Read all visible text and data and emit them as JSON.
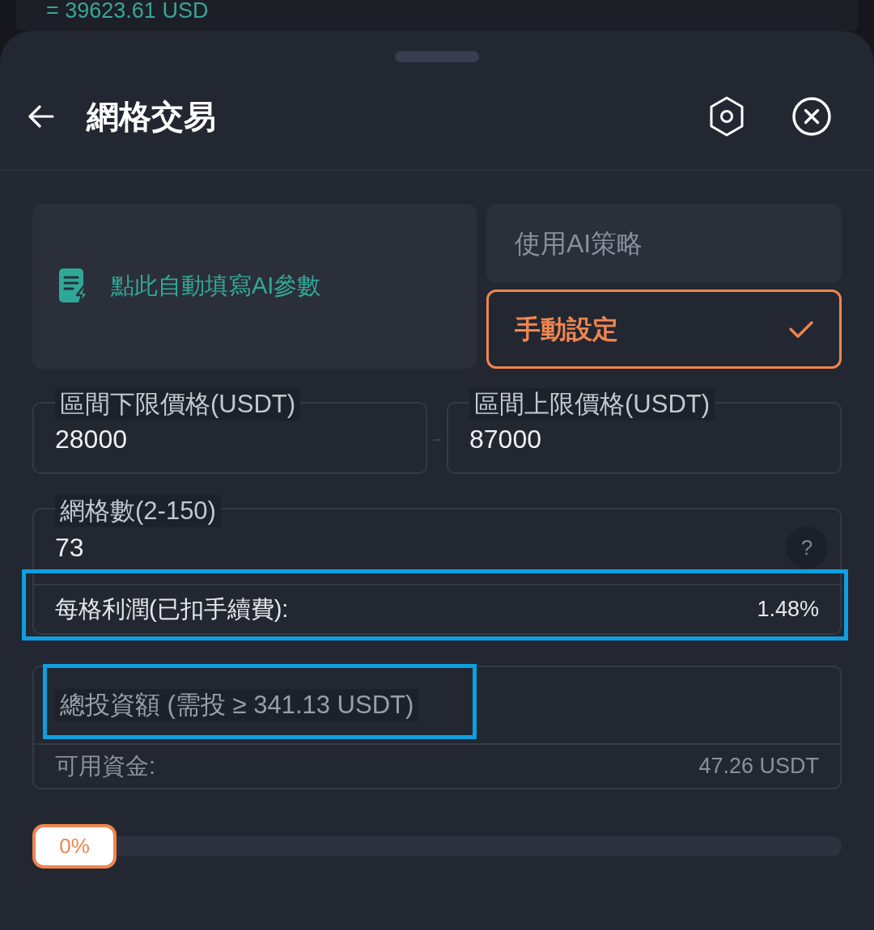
{
  "behind_sheet": {
    "balance": "= 39623.61 USD"
  },
  "sheet": {
    "title": "網格交易"
  },
  "ai_fill_button": {
    "label": "點此自動填寫AI參數"
  },
  "mode_options": [
    {
      "label": "使用AI策略",
      "selected": false
    },
    {
      "label": "手動設定",
      "selected": true
    }
  ],
  "price_range": [
    {
      "label": "區間下限價格(USDT)",
      "value": "28000"
    },
    {
      "label": "區間上限價格(USDT)",
      "value": "87000"
    }
  ],
  "grid_count": {
    "label": "網格數(2-150)",
    "value": "73",
    "help": "?"
  },
  "profit_row": {
    "label": "每格利潤(已扣手續費):",
    "value": "1.48%",
    "highlighted": true
  },
  "investment": {
    "label": "總投資額 (需投 ≥ 341.13 USDT)",
    "highlighted": true,
    "available_label": "可用資金:",
    "available_value": "47.26 USDT"
  },
  "slider": {
    "level": 0,
    "reading": "0%"
  }
}
